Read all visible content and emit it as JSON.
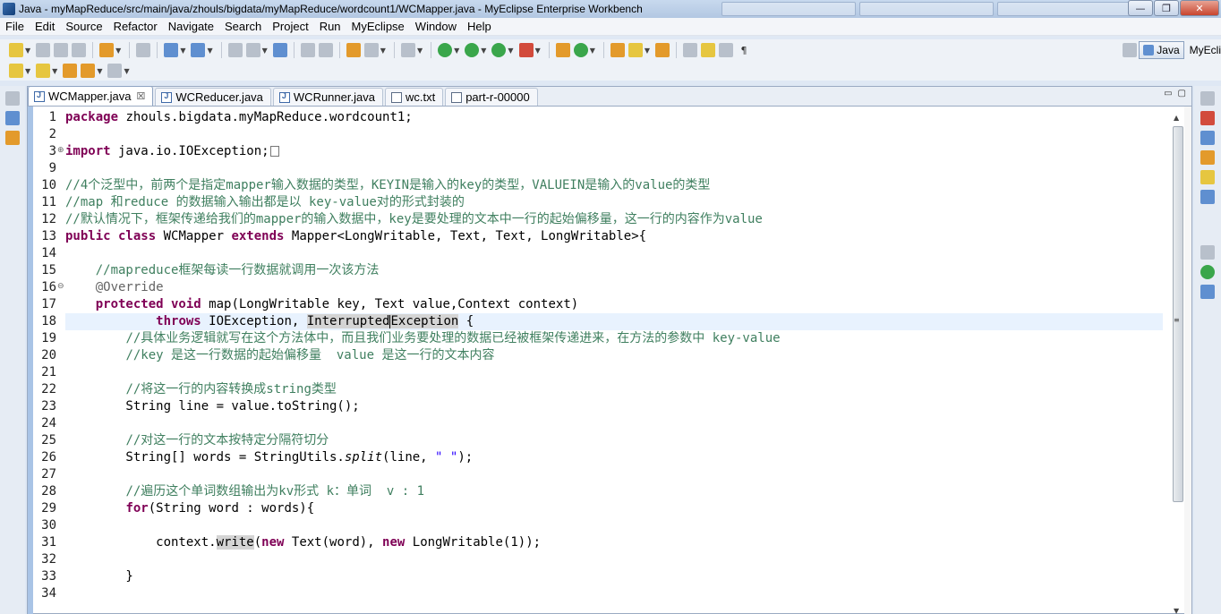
{
  "window": {
    "title": "Java - myMapReduce/src/main/java/zhouls/bigdata/myMapReduce/wordcount1/WCMapper.java - MyEclipse Enterprise Workbench",
    "buttons": {
      "minimize": "—",
      "maximize": "❐",
      "close": "✕"
    }
  },
  "menubar": [
    "File",
    "Edit",
    "Source",
    "Refactor",
    "Navigate",
    "Search",
    "Project",
    "Run",
    "MyEclipse",
    "Window",
    "Help"
  ],
  "perspective": {
    "java_label": "Java",
    "myeclipse_label": "MyEcli"
  },
  "tabs": [
    {
      "label": "WCMapper.java",
      "active": true,
      "close": "☒"
    },
    {
      "label": "WCReducer.java",
      "active": false
    },
    {
      "label": "WCRunner.java",
      "active": false
    },
    {
      "label": "wc.txt",
      "active": false
    },
    {
      "label": "part-r-00000",
      "active": false
    }
  ],
  "editor": {
    "current_line": 18,
    "lines": [
      {
        "n": "1",
        "html": "<span class=\"kw\">package</span> zhouls.bigdata.myMapReduce.wordcount1;"
      },
      {
        "n": "2",
        "html": ""
      },
      {
        "n": "3",
        "fold": "⊕",
        "html": "<span class=\"kw\">import</span> java.io.IOException;<span class=\"collapsed-box\"></span>"
      },
      {
        "n": "9",
        "html": ""
      },
      {
        "n": "10",
        "html": "<span class=\"cm\">//4个泛型中，前两个是指定mapper输入数据的类型，KEYIN是输入的key的类型，VALUEIN是输入的value的类型</span>"
      },
      {
        "n": "11",
        "html": "<span class=\"cm\">//map 和reduce 的数据输入输出都是以 key-value对的形式封装的</span>"
      },
      {
        "n": "12",
        "html": "<span class=\"cm\">//默认情况下，框架传递给我们的mapper的输入数据中，key是要处理的文本中一行的起始偏移量，这一行的内容作为value</span>"
      },
      {
        "n": "13",
        "html": "<span class=\"kw\">public class</span> WCMapper <span class=\"kw\">extends</span> Mapper&lt;LongWritable, Text, Text, LongWritable&gt;{"
      },
      {
        "n": "14",
        "html": ""
      },
      {
        "n": "15",
        "html": "    <span class=\"cm\">//mapreduce框架每读一行数据就调用一次该方法</span>"
      },
      {
        "n": "16",
        "fold": "⊖",
        "html": "    <span class=\"an\">@Override</span>"
      },
      {
        "n": "17",
        "html": "    <span class=\"kw\">protected void</span> map(LongWritable key, Text value,Context context)"
      },
      {
        "n": "18",
        "html": "            <span class=\"kw\">throws</span> IOException, <span class=\"hl\">Interrupted<span class=\"caret\"></span>Exception</span> {"
      },
      {
        "n": "19",
        "html": "        <span class=\"cm\">//具体业务逻辑就写在这个方法体中，而且我们业务要处理的数据已经被框架传递进来，在方法的参数中 key-value</span>"
      },
      {
        "n": "20",
        "html": "        <span class=\"cm\">//key 是这一行数据的起始偏移量  value 是这一行的文本内容</span>"
      },
      {
        "n": "21",
        "html": ""
      },
      {
        "n": "22",
        "html": "        <span class=\"cm\">//将这一行的内容转换成string类型</span>"
      },
      {
        "n": "23",
        "html": "        String line = value.toString();"
      },
      {
        "n": "24",
        "html": ""
      },
      {
        "n": "25",
        "html": "        <span class=\"cm\">//对这一行的文本按特定分隔符切分</span>"
      },
      {
        "n": "26",
        "html": "        String[] words = StringUtils.<span class=\"it\">split</span>(line, <span class=\"str\">\" \"</span>);"
      },
      {
        "n": "27",
        "html": ""
      },
      {
        "n": "28",
        "html": "        <span class=\"cm\">//遍历这个单词数组输出为kv形式 k：单词  v : 1</span>"
      },
      {
        "n": "29",
        "html": "        <span class=\"kw\">for</span>(String word : words){"
      },
      {
        "n": "30",
        "html": ""
      },
      {
        "n": "31",
        "html": "            context.<span class=\"hl\">write</span>(<span class=\"kw\">new</span> Text(word), <span class=\"kw\">new</span> LongWritable(1));"
      },
      {
        "n": "32",
        "html": ""
      },
      {
        "n": "33",
        "html": "        }"
      },
      {
        "n": "34",
        "html": ""
      }
    ]
  }
}
